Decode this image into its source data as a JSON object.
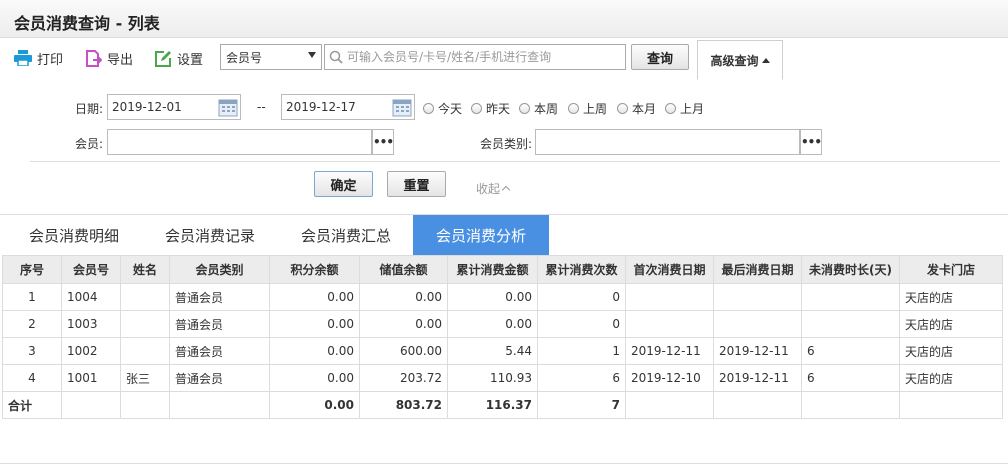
{
  "title": "会员消费查询 - 列表",
  "toolbar": {
    "print": "打印",
    "export": "导出",
    "settings": "设置",
    "select_value": "会员号",
    "search_placeholder": "可输入会员号/卡号/姓名/手机进行查询",
    "query": "查询",
    "advanced": "高级查询"
  },
  "filter": {
    "date_label": "日期:",
    "date_from": "2019-12-01",
    "date_sep": "--",
    "date_to": "2019-12-17",
    "quick": [
      "今天",
      "昨天",
      "本周",
      "上周",
      "本月",
      "上月"
    ],
    "member_label": "会员:",
    "member_value": "",
    "member_type_label": "会员类别:",
    "member_type_value": "",
    "confirm": "确定",
    "reset": "重置",
    "collapse": "收起"
  },
  "tabs": [
    "会员消费明细",
    "会员消费记录",
    "会员消费汇总",
    "会员消费分析"
  ],
  "active_tab": 3,
  "table": {
    "headers": [
      "序号",
      "会员号",
      "姓名",
      "会员类别",
      "积分余额",
      "储值余额",
      "累计消费金额",
      "累计消费次数",
      "首次消费日期",
      "最后消费日期",
      "未消费时长(天)",
      "发卡门店"
    ],
    "rows": [
      [
        "1",
        "1004",
        "",
        "普通会员",
        "0.00",
        "0.00",
        "0.00",
        "0",
        "",
        "",
        "",
        "天店的店"
      ],
      [
        "2",
        "1003",
        "",
        "普通会员",
        "0.00",
        "0.00",
        "0.00",
        "0",
        "",
        "",
        "",
        "天店的店"
      ],
      [
        "3",
        "1002",
        "",
        "普通会员",
        "0.00",
        "600.00",
        "5.44",
        "1",
        "2019-12-11",
        "2019-12-11",
        "6",
        "天店的店"
      ],
      [
        "4",
        "1001",
        "张三",
        "普通会员",
        "0.00",
        "203.72",
        "110.93",
        "6",
        "2019-12-10",
        "2019-12-11",
        "6",
        "天店的店"
      ]
    ],
    "total": [
      "合计",
      "",
      "",
      "",
      "0.00",
      "803.72",
      "116.37",
      "7",
      "",
      "",
      "",
      ""
    ]
  },
  "colors": {
    "accent": "#4a90e2",
    "print_icon": "#1a9bd7",
    "export_icon": "#c94fc4",
    "settings_icon": "#4aa84a"
  }
}
